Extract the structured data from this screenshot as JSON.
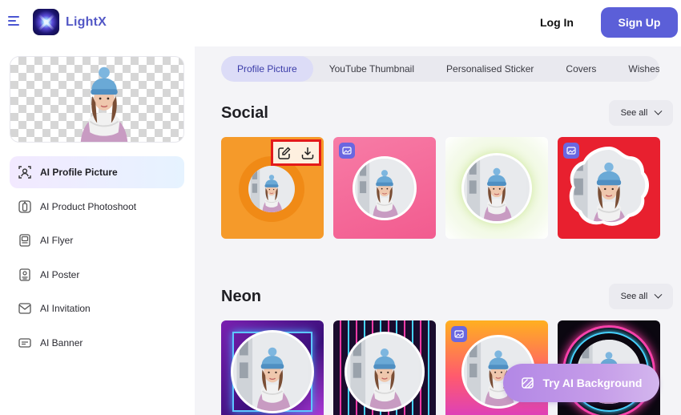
{
  "header": {
    "brand": "LightX",
    "login_label": "Log In",
    "signup_label": "Sign Up",
    "accent": "#5b5fd8"
  },
  "sidebar": {
    "items": [
      {
        "label": "AI Profile Picture",
        "icon": "profile-picture-icon",
        "active": true
      },
      {
        "label": "AI Product Photoshoot",
        "icon": "product-photoshoot-icon",
        "active": false
      },
      {
        "label": "AI Flyer",
        "icon": "flyer-icon",
        "active": false
      },
      {
        "label": "AI Poster",
        "icon": "poster-icon",
        "active": false
      },
      {
        "label": "AI Invitation",
        "icon": "invitation-icon",
        "active": false
      },
      {
        "label": "AI Banner",
        "icon": "banner-icon",
        "active": false
      }
    ]
  },
  "main": {
    "tabs": [
      {
        "label": "Profile Picture",
        "active": true
      },
      {
        "label": "YouTube Thumbnail",
        "active": false
      },
      {
        "label": "Personalised Sticker",
        "active": false
      },
      {
        "label": "Covers",
        "active": false
      },
      {
        "label": "Wishes",
        "active": false
      }
    ],
    "sections": [
      {
        "title": "Social",
        "see_all_label": "See all"
      },
      {
        "title": "Neon",
        "see_all_label": "See all"
      }
    ],
    "try_button_label": "Try AI Background",
    "card_actions": [
      "edit-icon",
      "download-icon"
    ]
  }
}
